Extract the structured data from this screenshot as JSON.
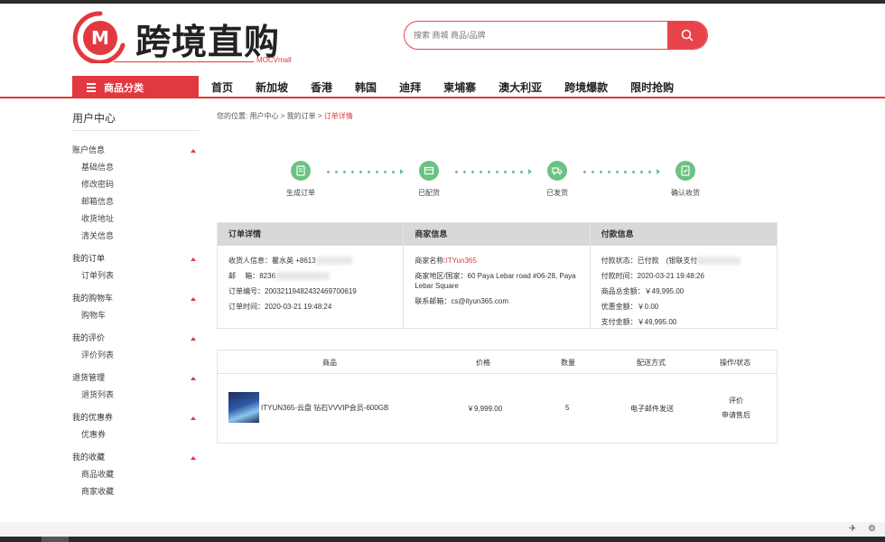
{
  "brand": {
    "name": "跨境直购",
    "sub": "MOCVmall",
    "logo_letter": "M",
    "accent": "#e2383f"
  },
  "search": {
    "placeholder": "搜索 商城 商品/品牌",
    "icon": "search-icon"
  },
  "nav": {
    "category_label": "商品分类",
    "items": [
      "首页",
      "新加坡",
      "香港",
      "韩国",
      "迪拜",
      "柬埔寨",
      "澳大利亚",
      "跨境爆款",
      "限时抢购"
    ]
  },
  "sidebar": {
    "title": "用户中心",
    "groups": [
      {
        "label": "账户信息",
        "links": [
          "基础信息",
          "修改密码",
          "邮箱信息",
          "收货地址",
          "清关信息"
        ]
      },
      {
        "label": "我的订单",
        "links": [
          "订单列表"
        ]
      },
      {
        "label": "我的购物车",
        "links": [
          "购物车"
        ]
      },
      {
        "label": "我的评价",
        "links": [
          "评价列表"
        ]
      },
      {
        "label": "退货管理",
        "links": [
          "退货列表"
        ]
      },
      {
        "label": "我的优惠券",
        "links": [
          "优惠券"
        ]
      },
      {
        "label": "我的收藏",
        "links": [
          "商品收藏",
          "商家收藏"
        ]
      }
    ]
  },
  "breadcrumb": {
    "prefix": "您的位置:",
    "items": [
      "用户中心",
      "我的订单"
    ],
    "current": "订单详情",
    "sep": ">"
  },
  "progress": {
    "steps": [
      "生成订单",
      "已配货",
      "已发货",
      "确认收货"
    ],
    "color": "#6bc283"
  },
  "order": {
    "detail_head": "订单详情",
    "receiver": "收货人信息：瞿水英 +8613",
    "address": "邮　 箱：8236",
    "order_no": "订单编号：20032119482432469700619",
    "order_time": "订单时间：2020-03-21 19:48:24",
    "merchant_head": "商家信息",
    "merchant_name_label": "商家名称:",
    "merchant_name": "ITYun365",
    "merchant_region": "商家地区/国家：60 Paya Lebar road #06-28, Paya Lebar Square",
    "merchant_email": "联系邮箱：cs@ityun365.com",
    "pay_head": "付款信息",
    "pay_status": "付款状态：已付款　(银联支付",
    "pay_time": "付款时间：2020-03-21 19:48:26",
    "goods_total": "商品总金额：￥49,995.00",
    "discount": "优惠金额：￥0.00",
    "paid": "支付金额：￥49,995.00"
  },
  "goods": {
    "headers": [
      "商品",
      "价格",
      "数量",
      "配送方式",
      "操作/状态"
    ],
    "row": {
      "name": "ITYUN365-云盘 钻石VVVIP会员-600GB",
      "price": "￥9,999.00",
      "qty": "5",
      "shipping": "电子邮件发送",
      "action1": "评价",
      "action2": "申请售后"
    }
  }
}
